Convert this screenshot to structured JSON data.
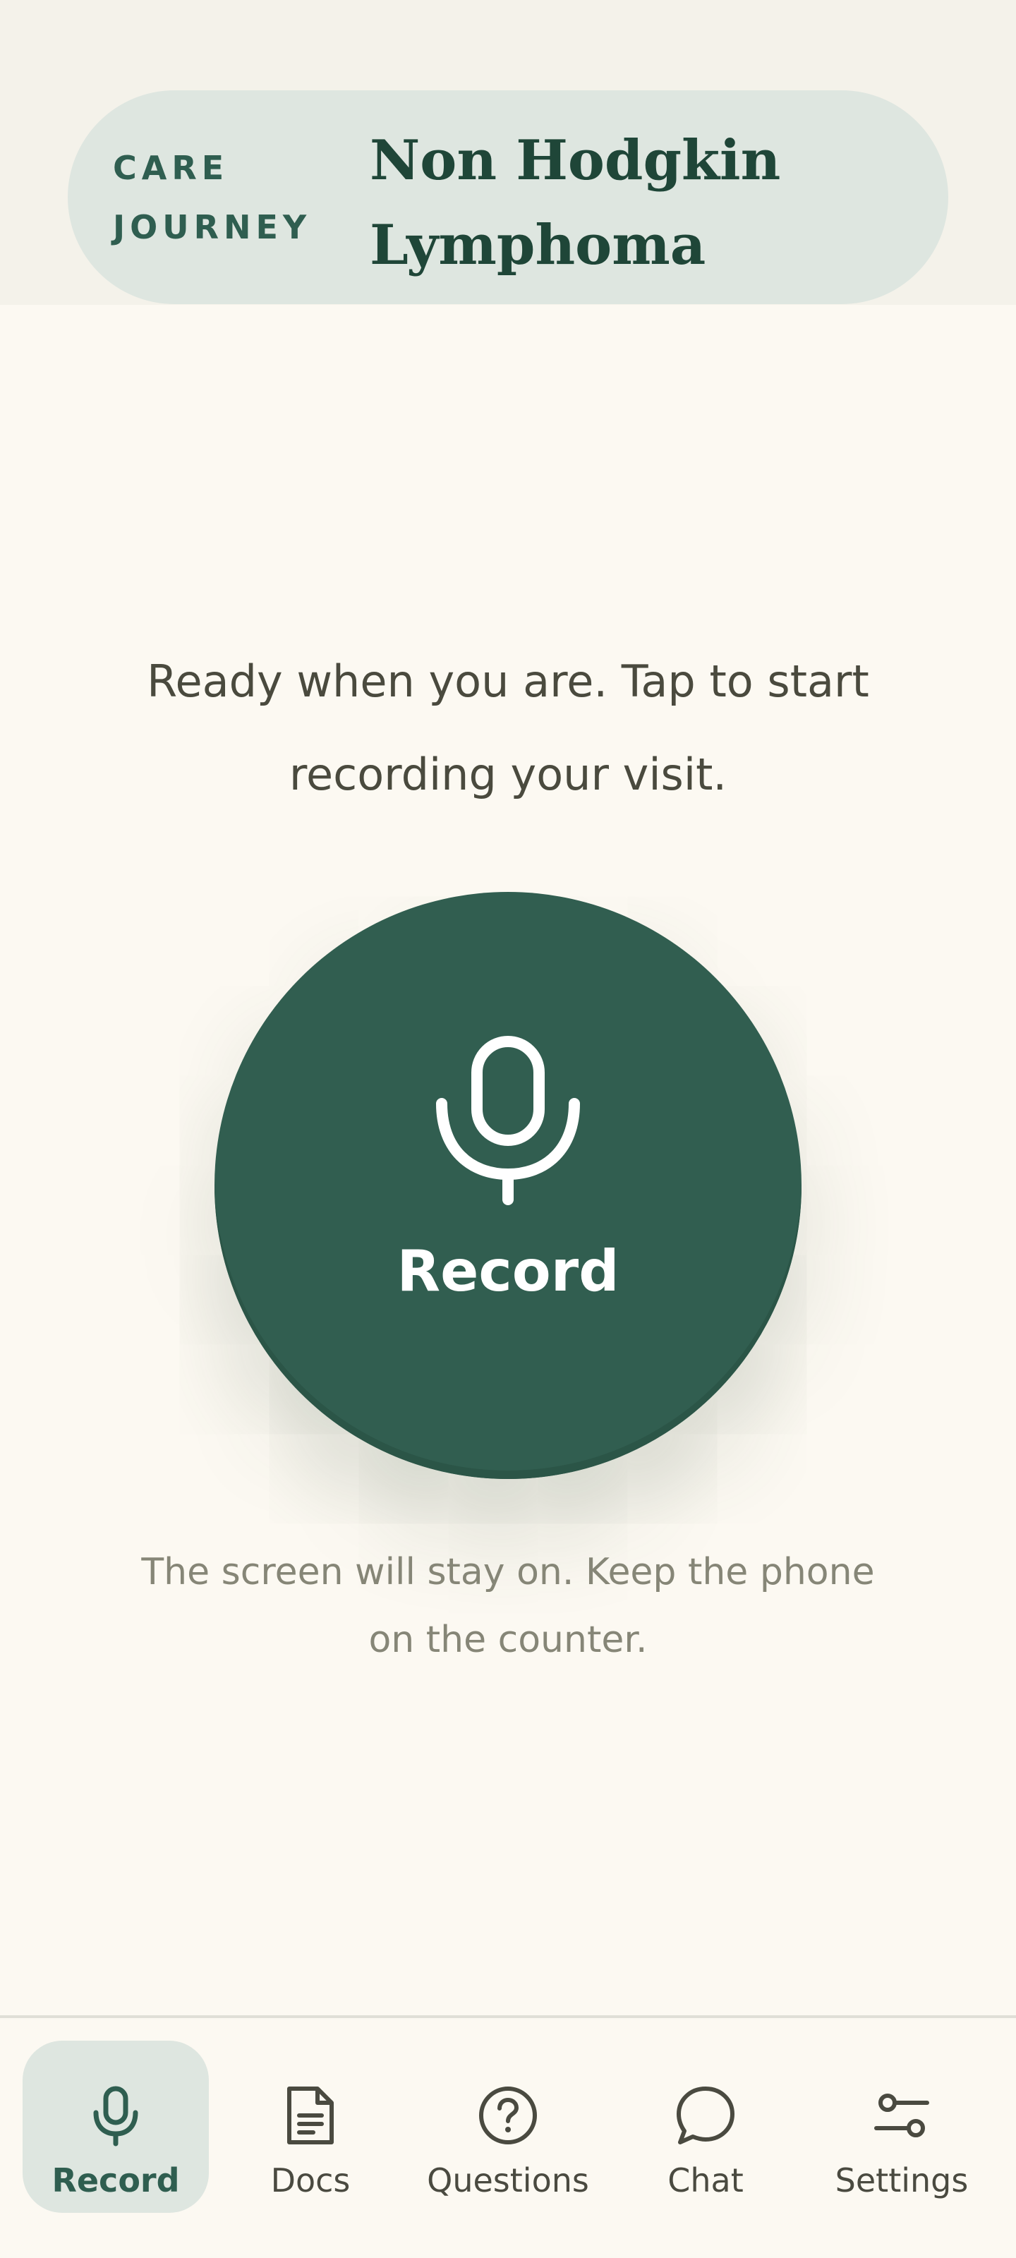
{
  "header": {
    "kicker": "CARE\nJOURNEY",
    "title": "Non Hodgkin Lymphoma"
  },
  "main": {
    "prompt": "Ready when you are. Tap to start recording your visit.",
    "record_label": "Record",
    "record_icon": "microphone-icon",
    "hint": "The screen will stay on. Keep the phone on the counter."
  },
  "nav": {
    "active": "Record",
    "items": [
      {
        "label": "Record",
        "icon": "microphone-icon"
      },
      {
        "label": "Docs",
        "icon": "document-icon"
      },
      {
        "label": "Questions",
        "icon": "question-circle-icon"
      },
      {
        "label": "Chat",
        "icon": "chat-bubble-icon"
      },
      {
        "label": "Settings",
        "icon": "sliders-icon"
      }
    ]
  },
  "colors": {
    "primary": "#315e50",
    "page_background": "#fcf9f2",
    "pill_background": "#dee6e0",
    "header_text": "#1f4638",
    "body_text": "#4a4a3e",
    "muted_text": "#868677"
  }
}
